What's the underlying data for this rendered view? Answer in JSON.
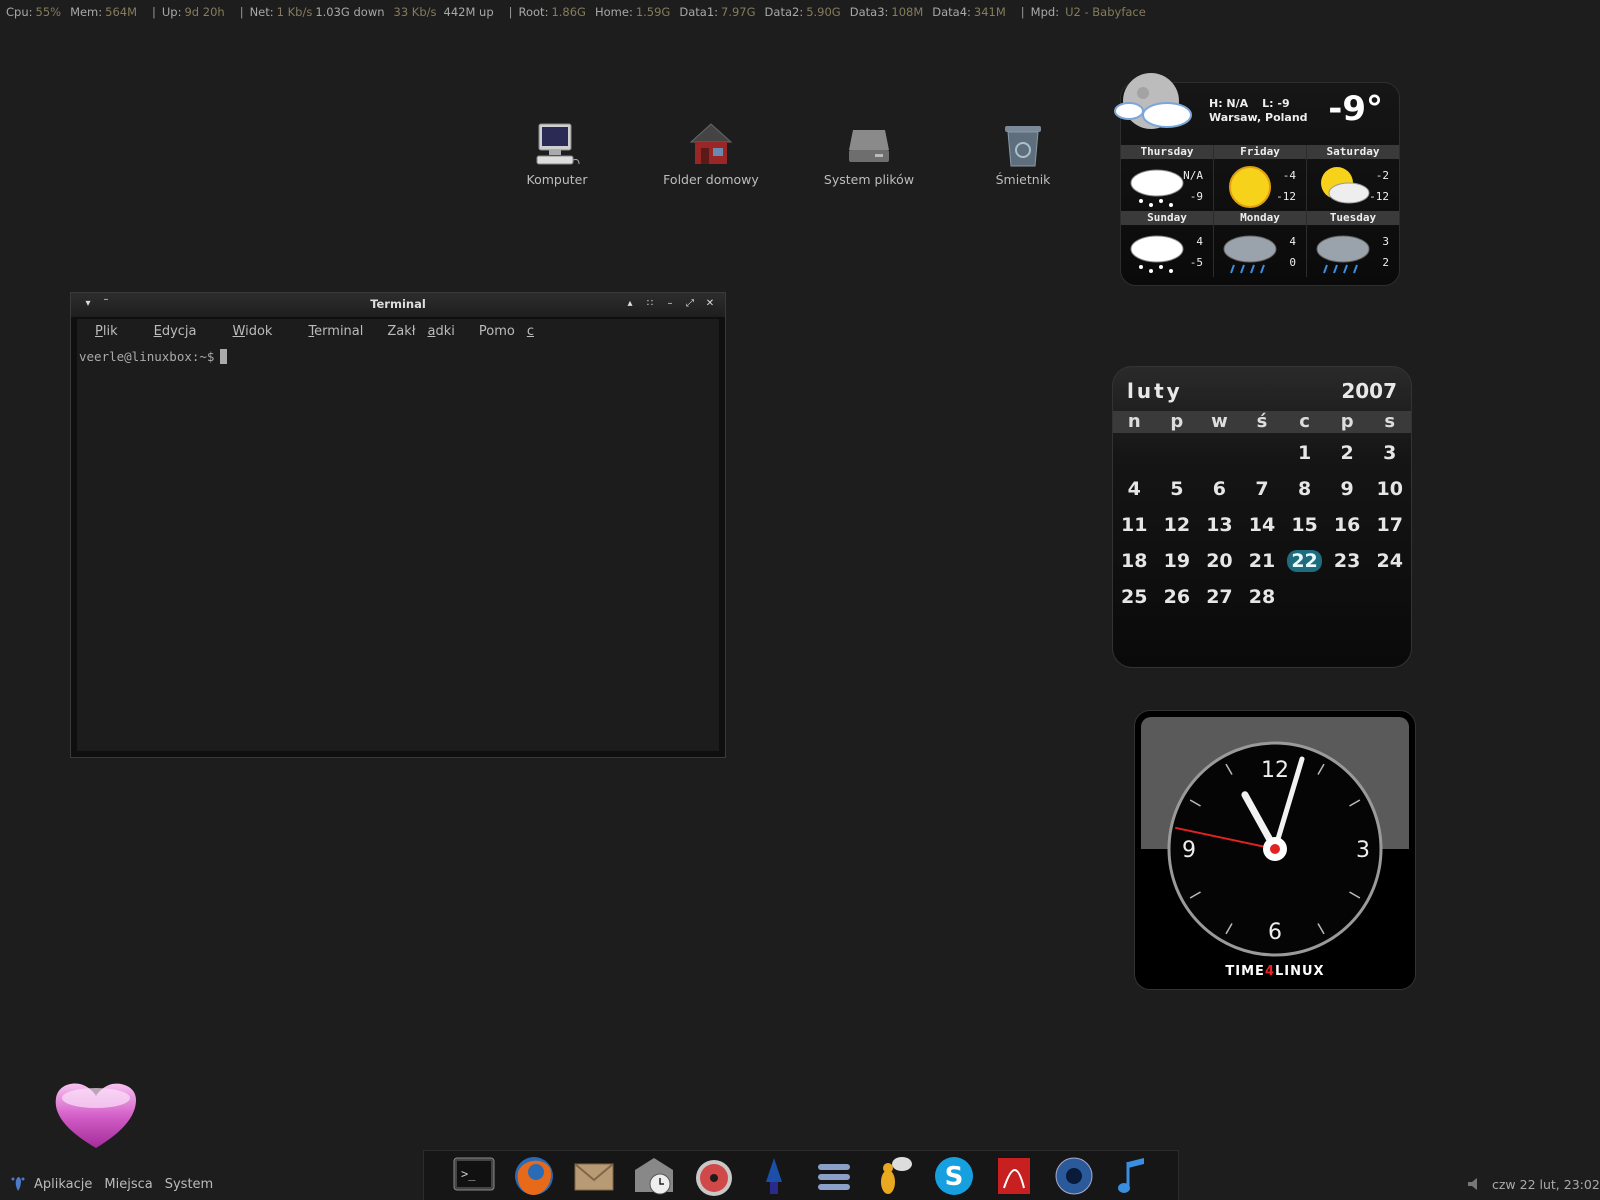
{
  "conky": {
    "cpu_label": "Cpu:",
    "cpu": "55%",
    "mem_label": "Mem:",
    "mem": "564M",
    "up_label": "Up:",
    "up": "9d 20h",
    "net_label": "Net:",
    "net": "1 Kb/s",
    "down_total": "1.03G down",
    "up_speed": "33 Kb/s",
    "up_total": "442M up",
    "root_label": "Root:",
    "root": "1.86G",
    "home_label": "Home:",
    "home": "1.59G",
    "data1_label": "Data1:",
    "data1": "7.97G",
    "data2_label": "Data2:",
    "data2": "5.90G",
    "data3_label": "Data3:",
    "data3": "108M",
    "data4_label": "Data4:",
    "data4": "341M",
    "mpd_label": "Mpd:",
    "mpd": "U2 - Babyface",
    "sep": "|"
  },
  "desktop": {
    "icons": [
      {
        "label": "Komputer",
        "icon": "computer-icon"
      },
      {
        "label": "Folder domowy",
        "icon": "home-folder-icon"
      },
      {
        "label": "System plików",
        "icon": "filesystem-drive-icon"
      },
      {
        "label": "Śmietnik",
        "icon": "trash-icon"
      }
    ]
  },
  "weather": {
    "high": "H: N/A",
    "low": "L: -9",
    "location": "Warsaw, Poland",
    "temp": "-9°",
    "days": [
      {
        "name": "Thursday",
        "hi": "N/A",
        "lo": "-9",
        "icon": "snow-icon"
      },
      {
        "name": "Friday",
        "hi": "-4",
        "lo": "-12",
        "icon": "sun-icon"
      },
      {
        "name": "Saturday",
        "hi": "-2",
        "lo": "-12",
        "icon": "partly-cloudy-icon"
      },
      {
        "name": "Sunday",
        "hi": "4",
        "lo": "-5",
        "icon": "snow-icon"
      },
      {
        "name": "Monday",
        "hi": "4",
        "lo": "0",
        "icon": "rain-icon"
      },
      {
        "name": "Tuesday",
        "hi": "3",
        "lo": "2",
        "icon": "rain-icon"
      }
    ]
  },
  "calendar": {
    "month": "luty",
    "year": "2007",
    "weekdays": [
      "n",
      "p",
      "w",
      "ś",
      "c",
      "p",
      "s"
    ],
    "days": [
      "",
      "",
      "",
      "",
      "1",
      "2",
      "3",
      "4",
      "5",
      "6",
      "7",
      "8",
      "9",
      "10",
      "11",
      "12",
      "13",
      "14",
      "15",
      "16",
      "17",
      "18",
      "19",
      "20",
      "21",
      "22",
      "23",
      "24",
      "25",
      "26",
      "27",
      "28",
      "",
      "",
      ""
    ],
    "today": "22",
    "today_color": "#1f6c7e"
  },
  "clock": {
    "n12": "12",
    "n3": "3",
    "n6": "6",
    "n9": "9",
    "brand_a": "TIME",
    "brand_b": "4",
    "brand_c": "LINUX",
    "hour": 11,
    "minute": 2,
    "second": 47
  },
  "terminal": {
    "title": "Terminal",
    "menu": [
      {
        "pre": "",
        "key": "P",
        "post": "lik"
      },
      {
        "pre": "",
        "key": "E",
        "post": "dycja"
      },
      {
        "pre": "",
        "key": "W",
        "post": "idok"
      },
      {
        "pre": "",
        "key": "T",
        "post": "erminal"
      },
      {
        "pre": "Zakł",
        "key": "a",
        "post": "dki"
      },
      {
        "pre": "Pomo",
        "key": "c",
        "post": ""
      }
    ],
    "prompt": "veerle@linuxbox:~$"
  },
  "panel": {
    "menus": [
      "Aplikacje",
      "Miejsca",
      "System"
    ],
    "datetime": "czw 22 lut, 23:02"
  },
  "dock": {
    "items": [
      "terminal-icon",
      "firefox-icon",
      "mail-icon",
      "mail-clock-icon",
      "cd-player-icon",
      "gimp-icon",
      "stack-icon",
      "pidgin-icon",
      "skype-icon",
      "pdf-reader-icon",
      "aperture-icon",
      "music-note-icon"
    ]
  },
  "colors": {
    "accent_today": "#1f6c7e",
    "clock_hand_second": "#e22222",
    "conky_value": "#857c5c"
  }
}
